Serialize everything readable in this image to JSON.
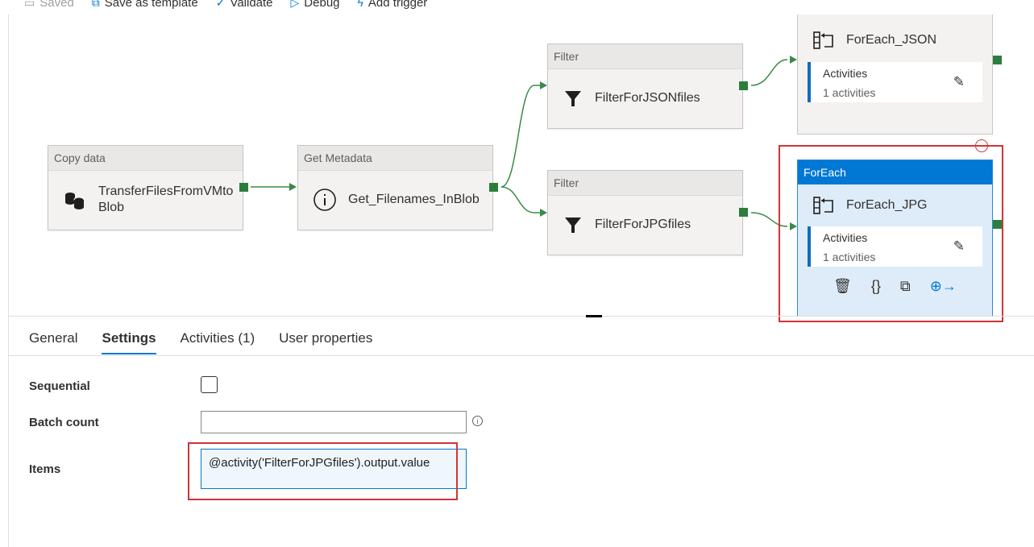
{
  "toolbar": {
    "saved_label": "Saved",
    "save_template_label": "Save as template",
    "validate_label": "Validate",
    "debug_label": "Debug",
    "add_trigger_label": "Add trigger"
  },
  "pipeline": {
    "copy": {
      "type": "Copy data",
      "name_line1": "TransferFilesFromVMto",
      "name_line2": "Blob",
      "icon": "copy-data-icon"
    },
    "getmeta": {
      "type": "Get Metadata",
      "name": "Get_Filenames_InBlob",
      "icon": "info-icon"
    },
    "filter_json": {
      "type": "Filter",
      "name": "FilterForJSONfiles",
      "icon": "filter-icon"
    },
    "filter_jpg": {
      "type": "Filter",
      "name": "FilterForJPGfiles",
      "icon": "filter-icon"
    },
    "foreach_json": {
      "name": "ForEach_JSON",
      "activities_label": "Activities",
      "activities_count": "1 activities"
    },
    "foreach_jpg": {
      "type": "ForEach",
      "name": "ForEach_JPG",
      "activities_label": "Activities",
      "activities_count": "1 activities"
    }
  },
  "tabs": [
    {
      "label": "General"
    },
    {
      "label": "Settings"
    },
    {
      "label": "Activities (1)"
    },
    {
      "label": "User properties"
    }
  ],
  "settings": {
    "sequential_label": "Sequential",
    "sequential_checked": false,
    "batch_count_label": "Batch count",
    "batch_count_value": "",
    "items_label": "Items",
    "items_value": "@activity('FilterForJPGfiles').output.value"
  },
  "colors": {
    "accent": "#0078d4",
    "success_port": "#2d7d3e",
    "highlight": "#d13438"
  }
}
